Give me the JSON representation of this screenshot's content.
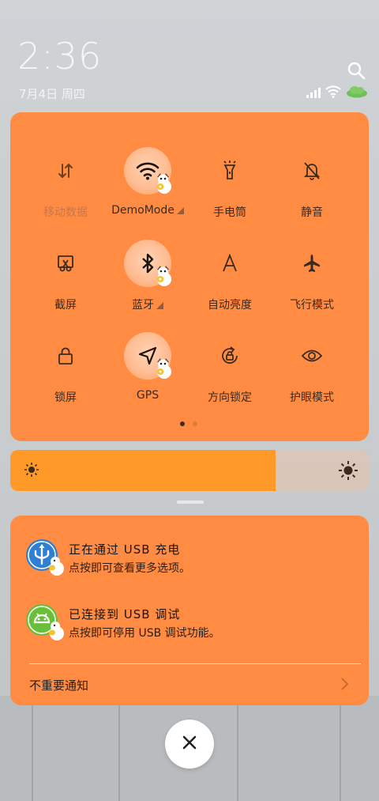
{
  "status_bar": {
    "time": "2:36",
    "date": "7月4日 周四",
    "icons": [
      "signal-icon",
      "wifi-icon",
      "cloud-icon"
    ]
  },
  "quick_settings": {
    "tiles": [
      {
        "id": "mobile-data",
        "label": "移动数据",
        "active": false,
        "icon": "data-arrows-icon"
      },
      {
        "id": "wifi",
        "label": "DemoMode",
        "active": true,
        "icon": "wifi-icon",
        "has_menu": true
      },
      {
        "id": "flashlight",
        "label": "手电筒",
        "active": false,
        "icon": "flashlight-icon"
      },
      {
        "id": "mute",
        "label": "静音",
        "active": false,
        "icon": "bell-off-icon"
      },
      {
        "id": "screenshot",
        "label": "截屏",
        "active": false,
        "icon": "scissors-icon"
      },
      {
        "id": "bluetooth",
        "label": "蓝牙",
        "active": true,
        "icon": "bluetooth-icon",
        "has_menu": true
      },
      {
        "id": "auto-brightness",
        "label": "自动亮度",
        "active": false,
        "icon": "letter-a-icon"
      },
      {
        "id": "airplane",
        "label": "飞行模式",
        "active": false,
        "icon": "airplane-icon"
      },
      {
        "id": "lock",
        "label": "锁屏",
        "active": false,
        "icon": "lock-icon"
      },
      {
        "id": "gps",
        "label": "GPS",
        "active": true,
        "icon": "location-arrow-icon"
      },
      {
        "id": "rotation-lock",
        "label": "方向锁定",
        "active": false,
        "icon": "rotation-lock-icon"
      },
      {
        "id": "eye-care",
        "label": "护眼模式",
        "active": false,
        "icon": "eye-icon"
      }
    ],
    "page_index": 1,
    "page_count": 2
  },
  "brightness": {
    "level": 0.74
  },
  "notifications": {
    "items": [
      {
        "title": "正在通过 USB 充电",
        "subtitle": "点按即可查看更多选项。",
        "icon": "usb-icon",
        "icon_color": "#2f7fd2"
      },
      {
        "title": "已连接到 USB 调试",
        "subtitle": "点按即可停用 USB 调试功能。",
        "icon": "android-icon",
        "icon_color": "#6abf3a"
      }
    ],
    "footer": "不重要通知"
  },
  "colors": {
    "panel": "#ff8c42",
    "brightness_fill": "#ff9a28",
    "active_bubble": "#ffbd93"
  }
}
